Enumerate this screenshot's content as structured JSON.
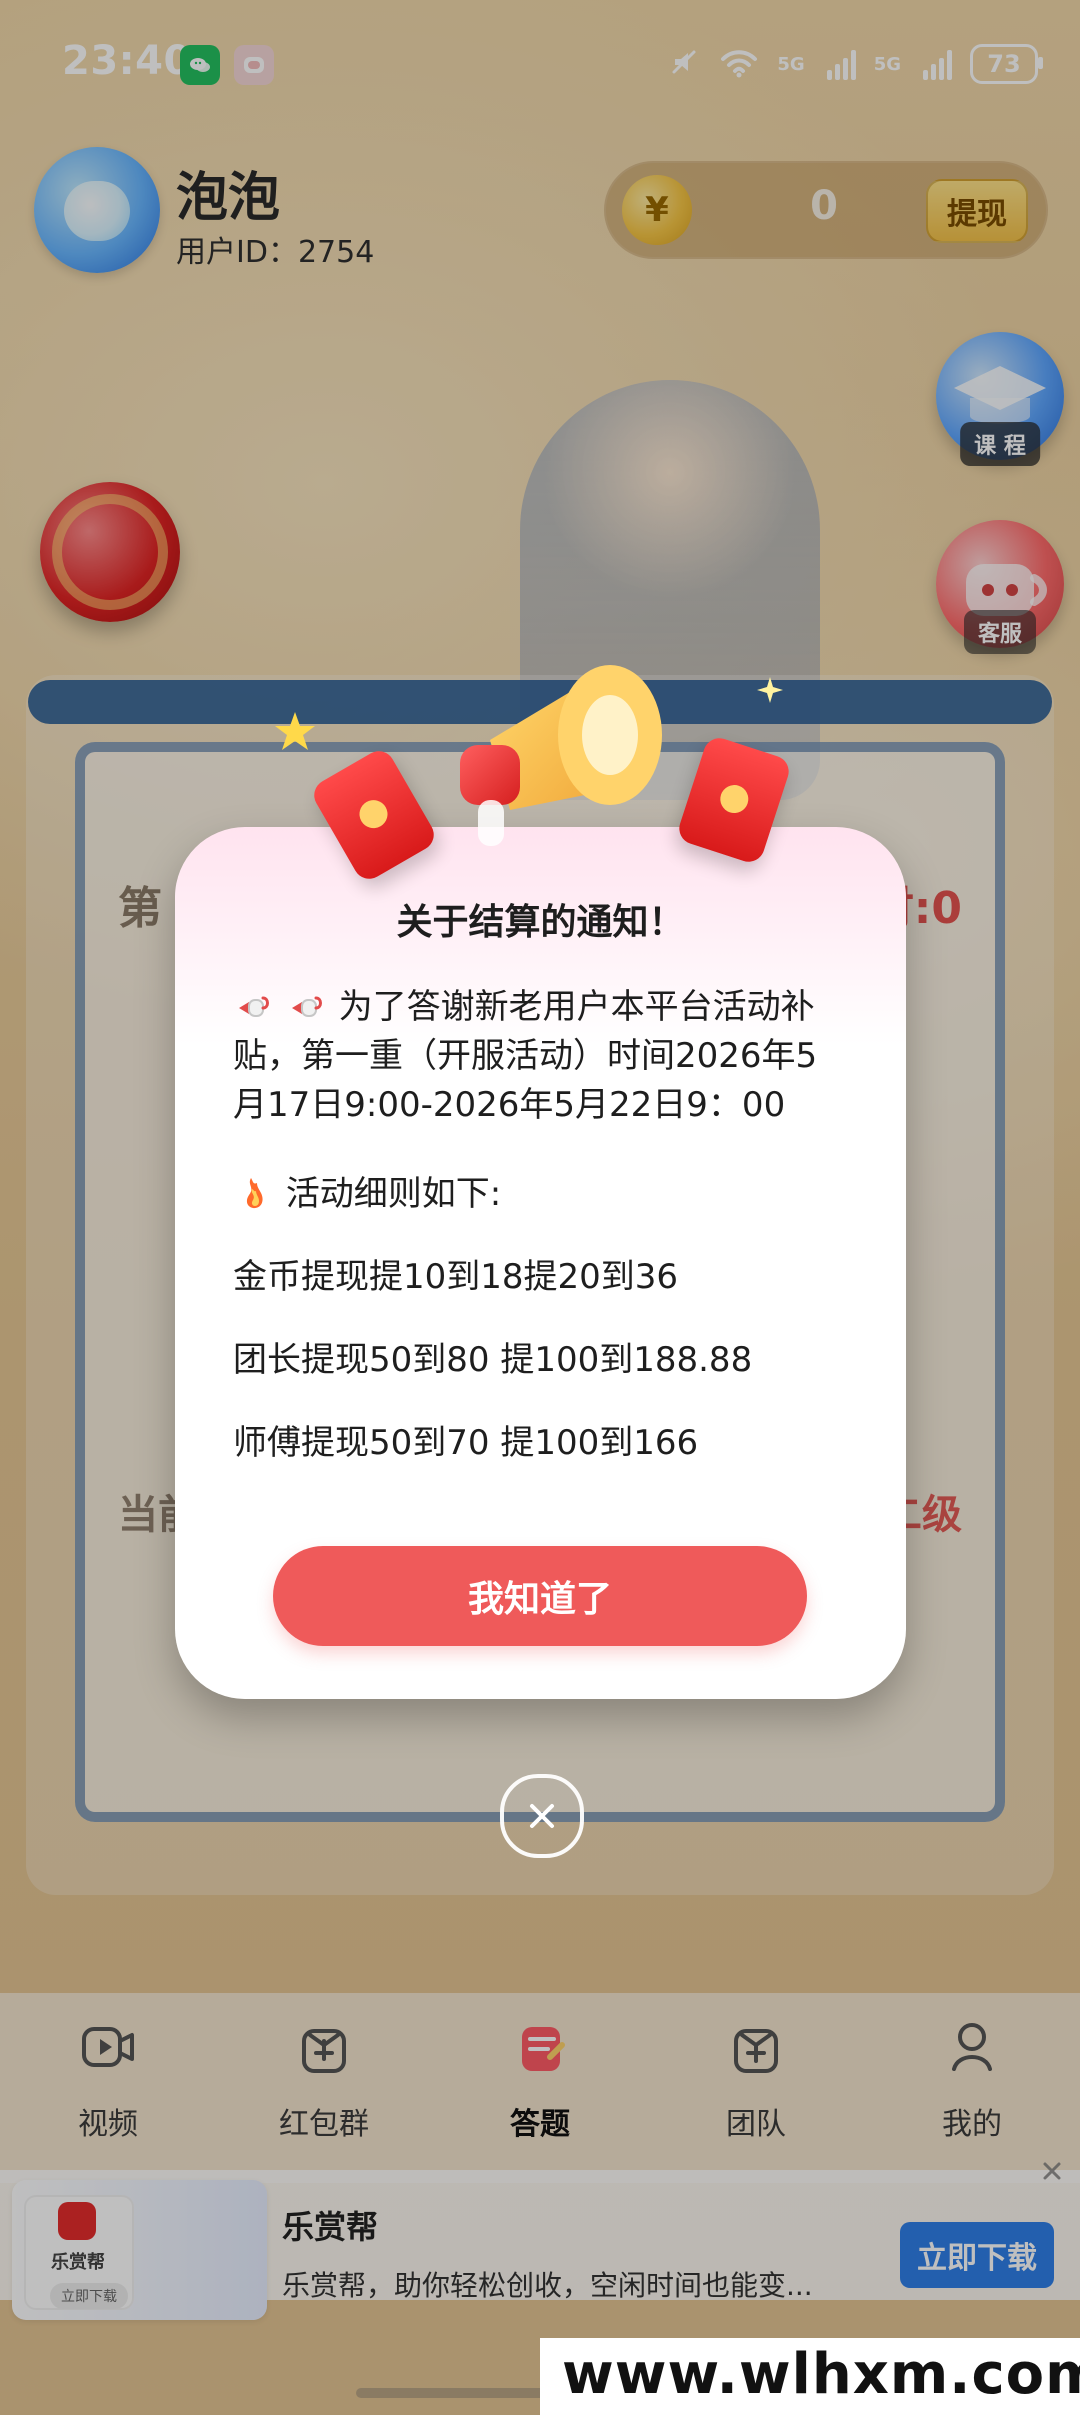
{
  "status_bar": {
    "time": "23:40",
    "battery": "73",
    "network_1": "5G",
    "network_2": "5G",
    "icons": [
      "wechat-icon",
      "notification-app-icon",
      "mute-icon",
      "wifi-icon",
      "signal-icon",
      "battery-icon"
    ]
  },
  "header": {
    "name": "泡泡",
    "user_id": "用户ID：2754",
    "coin_amount": "0",
    "withdraw_label": "提现",
    "coin_symbol": "¥"
  },
  "floating_buttons": {
    "course_label": "课 程",
    "support_label": "客服"
  },
  "background_fragments": {
    "left_top": "第",
    "right_top": "时:0",
    "left_bottom": "当前",
    "right_bottom": "二级"
  },
  "modal": {
    "title": "关于结算的通知！",
    "paragraph_1": "为了答谢新老用户本平台活动补贴，第一重（开服活动）时间2026年5月17日9:00-2026年5月22日9：00",
    "rules_heading": "活动细则如下:",
    "rule_1": "金币提现提10到18提20到36",
    "rule_2": "团长提现50到80 提100到188.88",
    "rule_3": "师傅提现50到70 提100到166",
    "confirm_button": "我知道了"
  },
  "bottom_nav": {
    "items": [
      {
        "label": "视频",
        "icon": "video-icon"
      },
      {
        "label": "红包群",
        "icon": "redpacket-group-icon"
      },
      {
        "label": "答题",
        "icon": "quiz-icon"
      },
      {
        "label": "团队",
        "icon": "team-icon"
      },
      {
        "label": "我的",
        "icon": "profile-icon"
      }
    ]
  },
  "ad": {
    "thumb_name": "乐赏帮",
    "thumb_btn": "立即下载",
    "title": "乐赏帮",
    "desc": "乐赏帮，助你轻松创收，空闲时间也能变...",
    "cta": "立即下载"
  },
  "watermark": {
    "text": "www.wlhxm.com"
  }
}
